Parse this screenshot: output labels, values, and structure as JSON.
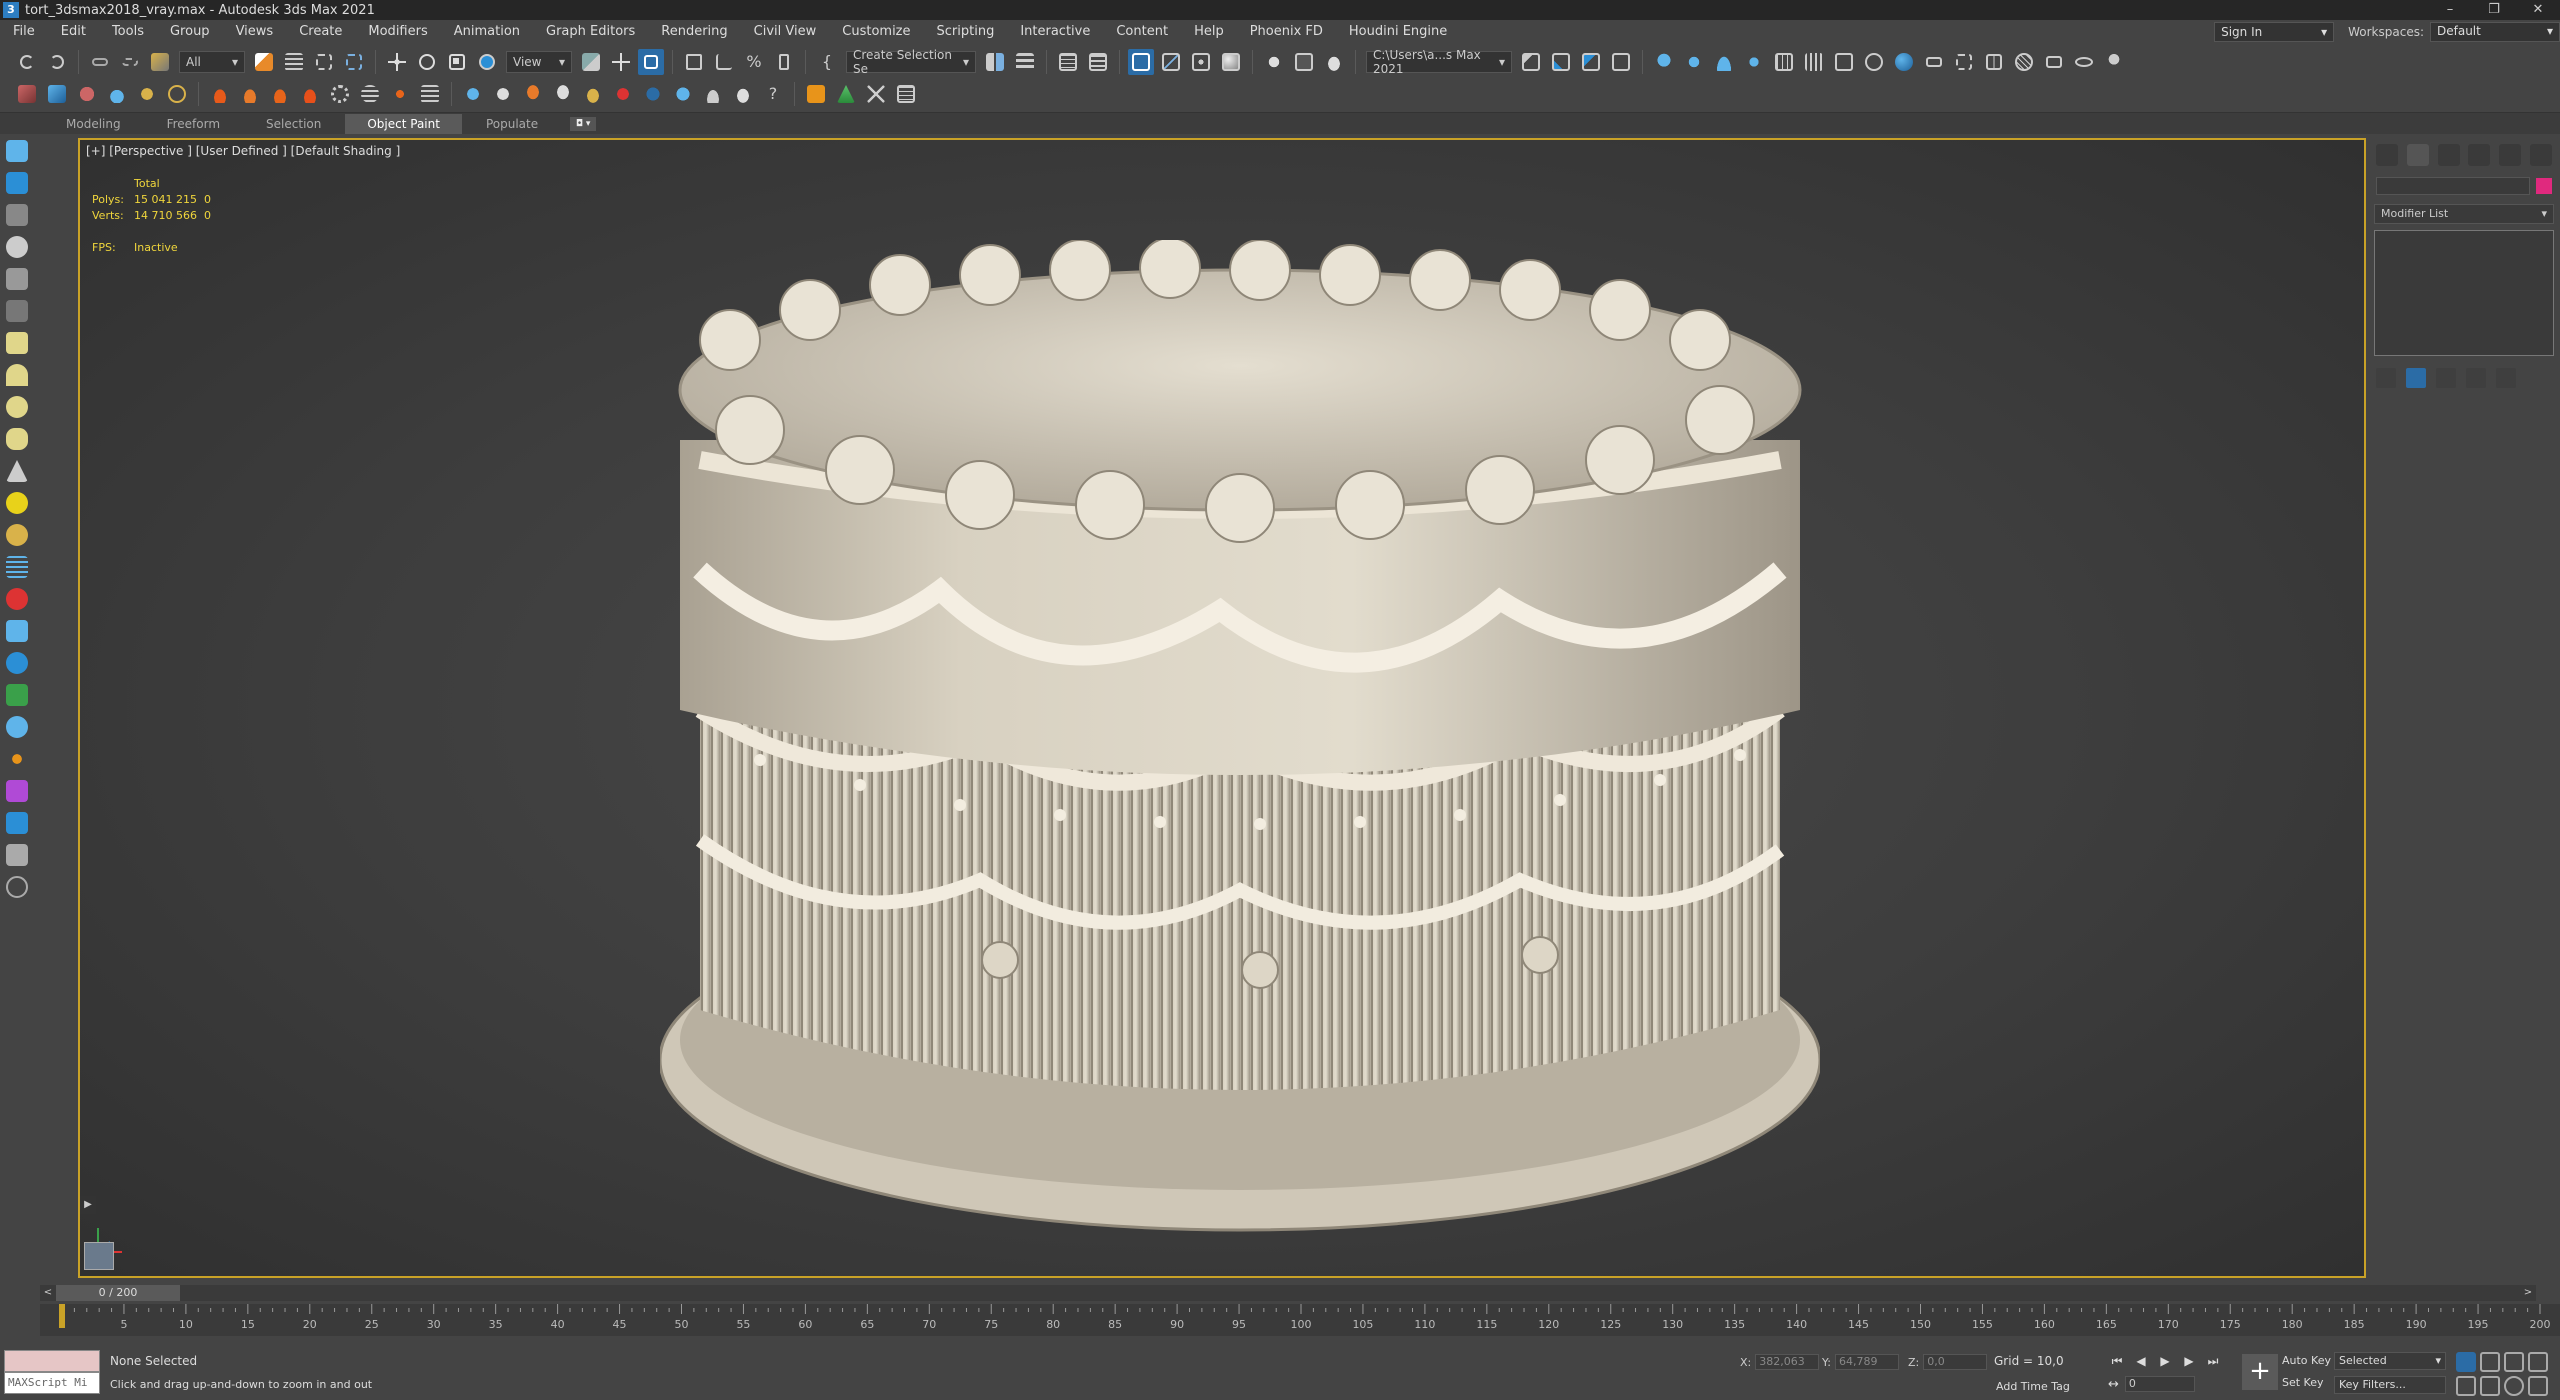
{
  "window": {
    "title": "tort_3dsmax2018_vray.max - Autodesk 3ds Max 2021",
    "app_icon_letter": "3",
    "controls": [
      "–",
      "❐",
      "✕"
    ]
  },
  "menu": {
    "items": [
      "File",
      "Edit",
      "Tools",
      "Group",
      "Views",
      "Create",
      "Modifiers",
      "Animation",
      "Graph Editors",
      "Rendering",
      "Civil View",
      "Customize",
      "Scripting",
      "Interactive",
      "Content",
      "Help",
      "Phoenix FD",
      "Houdini Engine"
    ],
    "sign_in": "Sign In",
    "workspaces_label": "Workspaces:",
    "workspace_value": "Default"
  },
  "toolbar": {
    "filter_value": "All",
    "view_value": "View",
    "selection_set_value": "Create Selection Se",
    "project_path": "C:\\Users\\a...s Max 2021"
  },
  "ribbon": {
    "tabs": [
      "Modeling",
      "Freeform",
      "Selection",
      "Object Paint",
      "Populate"
    ],
    "active_tab": "Object Paint"
  },
  "viewport": {
    "label": "[+] [Perspective ] [User Defined ] [Default Shading ]",
    "stats_header": "Total",
    "polys_label": "Polys:",
    "polys_total": "15 041 215",
    "polys_selected": "0",
    "verts_label": "Verts:",
    "verts_total": "14 710 566",
    "verts_selected": "0",
    "fps_label": "FPS:",
    "fps_value": "Inactive"
  },
  "command_panel": {
    "modifier_list": "Modifier List"
  },
  "timeline": {
    "frame_display": "0 / 200",
    "ticks": [
      5,
      10,
      15,
      20,
      25,
      30,
      35,
      40,
      45,
      50,
      55,
      60,
      65,
      70,
      75,
      80,
      85,
      90,
      95,
      100,
      105,
      110,
      115,
      120,
      125,
      130,
      135,
      140,
      145,
      150,
      155,
      160,
      165,
      170,
      175,
      180,
      185,
      190,
      195,
      200
    ]
  },
  "status": {
    "maxscript_placeholder": "MAXScript Mi",
    "selection": "None Selected",
    "prompt": "Click and drag up-and-down to zoom in and out",
    "x_label": "X:",
    "x_value": "382,063",
    "y_label": "Y:",
    "y_value": "64,789",
    "z_label": "Z:",
    "z_value": "0,0",
    "grid": "Grid = 10,0",
    "add_time_tag": "Add Time Tag",
    "auto_key": "Auto Key",
    "set_key": "Set Key",
    "key_mode": "Selected",
    "key_filters": "Key Filters...",
    "current_frame": "0"
  },
  "colors": {
    "viewport_border": "#c9a227",
    "stats_text": "#f0d63c",
    "active_blue": "#2b6ca6",
    "object_color": "#e0297e",
    "cake": "#d9d2c3"
  }
}
